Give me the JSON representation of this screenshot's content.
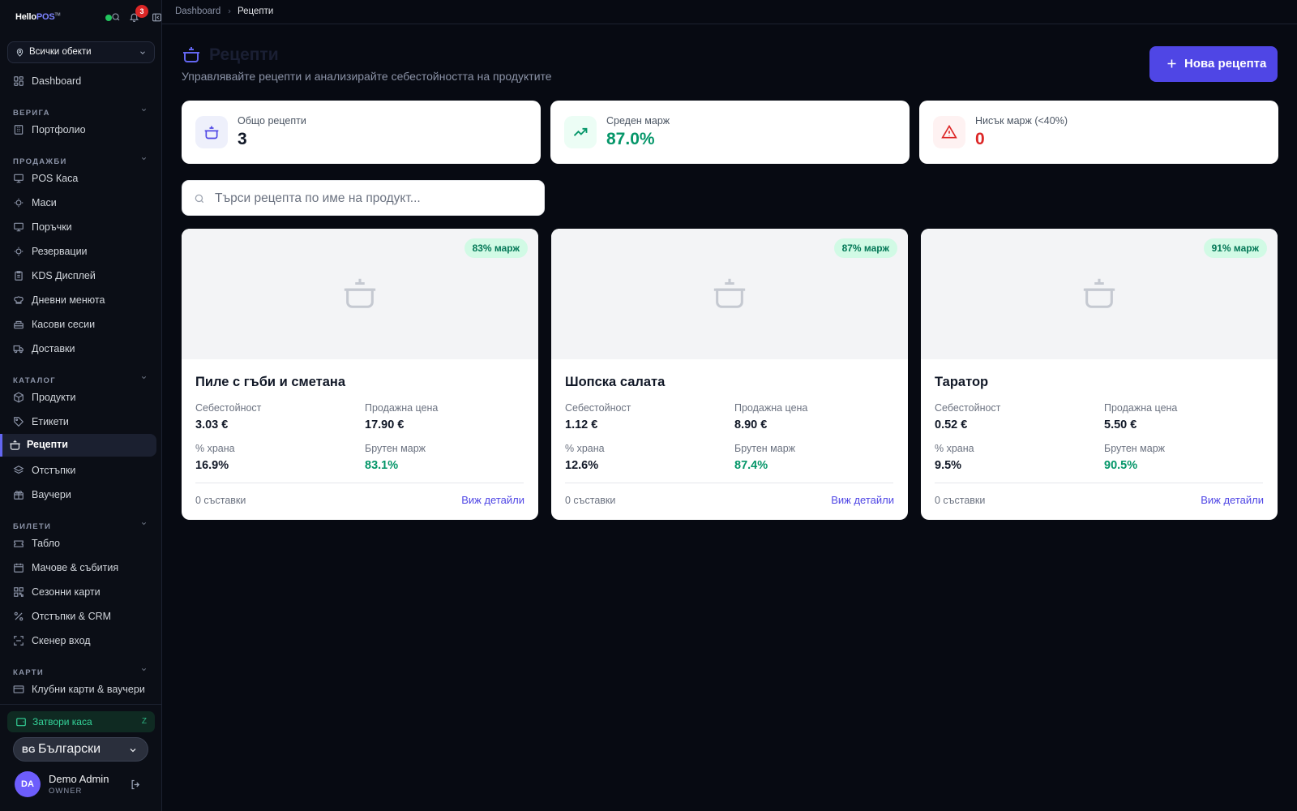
{
  "app": {
    "logo_main": "Hello",
    "logo_accent": "POS",
    "logo_tm": "TM",
    "notifications_count": "3"
  },
  "sidebar": {
    "location_select": "Всички обекти",
    "dashboard": "Dashboard",
    "sections": {
      "chain": "ВЕРИГА",
      "sales": "ПРОДАЖБИ",
      "catalog": "КАТАЛОГ",
      "tickets": "БИЛЕТИ",
      "cards": "КАРТИ"
    },
    "items": {
      "portfolio": "Портфолио",
      "pos": "POS Каса",
      "tables": "Маси",
      "orders": "Поръчки",
      "reservations": "Резервации",
      "kds": "KDS Дисплей",
      "daily_menus": "Дневни менюта",
      "cash_sessions": "Касови сесии",
      "deliveries": "Доставки",
      "products": "Продукти",
      "labels": "Етикети",
      "recipes": "Рецепти",
      "discounts": "Отстъпки",
      "vouchers": "Ваучери",
      "board": "Табло",
      "matches": "Мачове & събития",
      "season_cards": "Сезонни карти",
      "discounts_crm": "Отстъпки & CRM",
      "scanner": "Скенер вход",
      "club_cards": "Клубни карти & ваучери"
    },
    "close_cash": "Затвори каса",
    "close_cash_key": "Z",
    "language_flag": "BG",
    "language": "Български",
    "user": {
      "initials": "DA",
      "name": "Demo Admin",
      "role": "OWNER"
    }
  },
  "breadcrumb": {
    "parent": "Dashboard",
    "current": "Рецепти"
  },
  "header": {
    "title": "Рецепти",
    "subtitle": "Управлявайте рецепти и анализирайте себестойността на продуктите",
    "new_button": "Нова рецепта"
  },
  "stats": [
    {
      "label": "Общо рецепти",
      "value": "3",
      "color": "#111827",
      "bg": "#eef0fb",
      "icon_color": "#4f46e5"
    },
    {
      "label": "Среден марж",
      "value": "87.0%",
      "color": "#059669",
      "bg": "#ecfdf5",
      "icon_color": "#059669"
    },
    {
      "label": "Нисък марж (<40%)",
      "value": "0",
      "color": "#dc2626",
      "bg": "#fef2f2",
      "icon_color": "#dc2626"
    }
  ],
  "search": {
    "placeholder": "Търси рецепта по име на продукт..."
  },
  "card_labels": {
    "cost": "Себестойност",
    "sale_price": "Продажна цена",
    "food_pct": "% храна",
    "gross_margin": "Брутен марж",
    "view_details": "Виж детайли"
  },
  "recipes": [
    {
      "name": "Пиле с гъби и сметана",
      "badge": "83% марж",
      "cost": "3.03 €",
      "price": "17.90 €",
      "food_pct": "16.9%",
      "margin": "83.1%",
      "ingredients": "0 съставки"
    },
    {
      "name": "Шопска салата",
      "badge": "87% марж",
      "cost": "1.12 €",
      "price": "8.90 €",
      "food_pct": "12.6%",
      "margin": "87.4%",
      "ingredients": "0 съставки"
    },
    {
      "name": "Таратор",
      "badge": "91% марж",
      "cost": "0.52 €",
      "price": "5.50 €",
      "food_pct": "9.5%",
      "margin": "90.5%",
      "ingredients": "0 съставки"
    }
  ],
  "colors": {
    "accent": "#4f46e5",
    "success": "#059669",
    "danger": "#dc2626",
    "background": "#070a12"
  }
}
